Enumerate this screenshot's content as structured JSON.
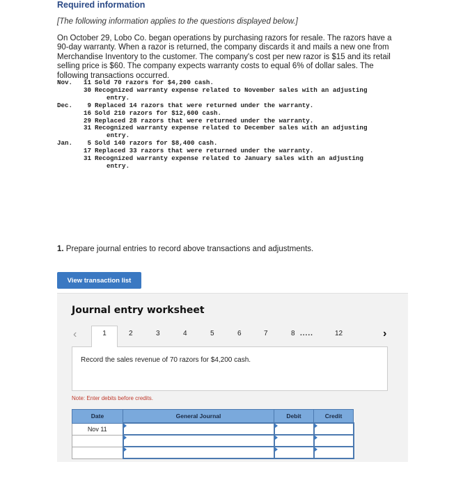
{
  "header": {
    "title": "Required information",
    "subtitle": "[The following information applies to the questions displayed below.]"
  },
  "intro": "On October 29, Lobo Co. began operations by purchasing razors for resale. The razors have a 90-day warranty. When a razor is returned, the company discards it and mails a new one from Merchandise Inventory to the customer. The company's cost per new razor is $15 and its retail selling price is $60. The company expects warranty costs to equal 6%  of dollar sales. The following transactions occurred.",
  "transactions": [
    {
      "month": "Nov.",
      "day": "11",
      "text": "Sold 70 razors for $4,200 cash.",
      "cont": ""
    },
    {
      "month": "",
      "day": "30",
      "text": "Recognized warranty expense related to November sales with an adjusting",
      "cont": "entry."
    },
    {
      "month": "Dec.",
      "day": "9",
      "text": "Replaced 14 razors that were returned under the warranty.",
      "cont": ""
    },
    {
      "month": "",
      "day": "16",
      "text": "Sold 210 razors for $12,600 cash.",
      "cont": ""
    },
    {
      "month": "",
      "day": "29",
      "text": "Replaced 28 razors that were returned under the warranty.",
      "cont": ""
    },
    {
      "month": "",
      "day": "31",
      "text": "Recognized warranty expense related to December sales with an adjusting",
      "cont": "entry."
    },
    {
      "month": "Jan.",
      "day": "5",
      "text": "Sold 140 razors for $8,400 cash.",
      "cont": ""
    },
    {
      "month": "",
      "day": "17",
      "text": "Replaced 33 razors that were returned under the warranty.",
      "cont": ""
    },
    {
      "month": "",
      "day": "31",
      "text": "Recognized warranty expense related to January sales with an adjusting",
      "cont": "entry."
    }
  ],
  "question": {
    "number": "1.",
    "text": " Prepare journal entries to record above transactions and adjustments."
  },
  "view_button": "View transaction list",
  "worksheet": {
    "title": "Journal entry worksheet",
    "prev_icon": "‹",
    "next_icon": "›",
    "tabs": [
      "1",
      "2",
      "3",
      "4",
      "5",
      "6",
      "7",
      "8",
      "12"
    ],
    "ellipsis": ".....",
    "active_tab": "1",
    "description": "Record the sales revenue of 70 razors for $4,200 cash.",
    "note": "Note: Enter debits before credits.",
    "table": {
      "headers": [
        "Date",
        "General Journal",
        "Debit",
        "Credit"
      ],
      "rows": [
        {
          "date": "Nov 11",
          "account": "",
          "debit": "",
          "credit": ""
        },
        {
          "date": "",
          "account": "",
          "debit": "",
          "credit": ""
        },
        {
          "date": "",
          "account": "",
          "debit": "",
          "credit": ""
        }
      ]
    }
  },
  "colors": {
    "title_blue": "#2b4a86",
    "button_blue": "#3a78c2",
    "header_blue": "#7aa9dc",
    "note_red": "#c0392b"
  }
}
